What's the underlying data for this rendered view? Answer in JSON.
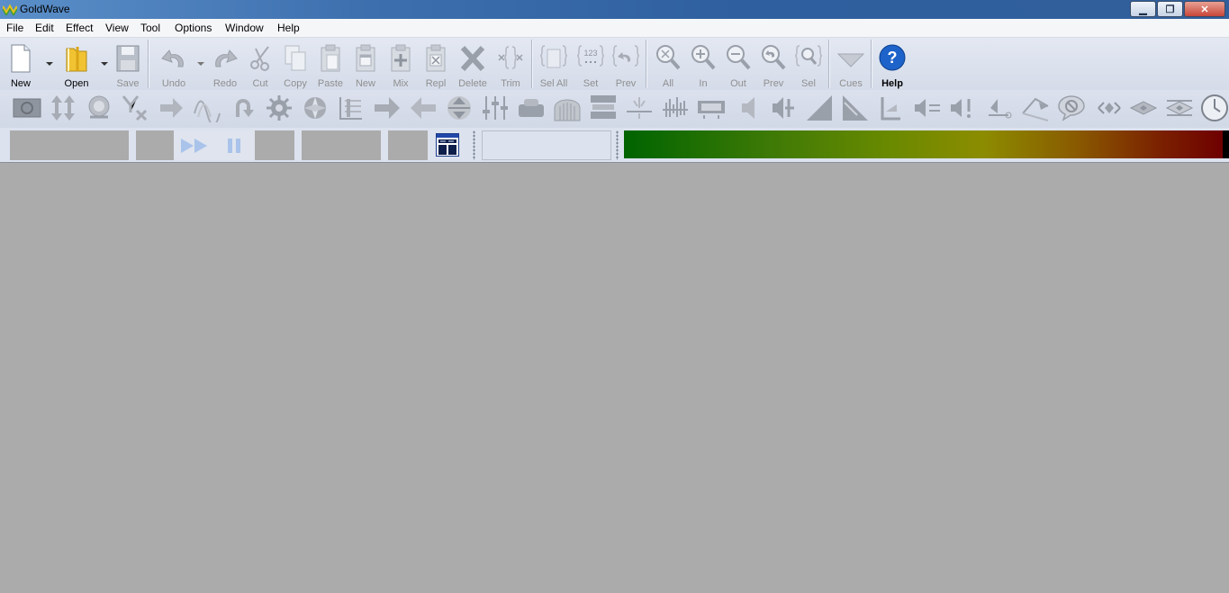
{
  "window": {
    "title": "GoldWave",
    "min_icon": "minimize-icon",
    "max_icon": "restore-icon",
    "close_icon": "close-icon"
  },
  "menu": [
    "File",
    "Edit",
    "Effect",
    "View",
    "Tool",
    "Options",
    "Window",
    "Help"
  ],
  "toolbar": {
    "new": "New",
    "open": "Open",
    "save": "Save",
    "undo": "Undo",
    "redo": "Redo",
    "cut": "Cut",
    "copy": "Copy",
    "paste": "Paste",
    "paste_new": "New",
    "mix": "Mix",
    "replace": "Repl",
    "delete": "Delete",
    "trim": "Trim",
    "sel_all": "Sel All",
    "set": "Set",
    "prev_sel": "Prev",
    "zoom_all": "All",
    "zoom_in": "In",
    "zoom_out": "Out",
    "zoom_prev": "Prev",
    "zoom_sel": "Sel",
    "cues": "Cues",
    "help": "Help",
    "set_icon_text": "123"
  },
  "effects": [
    "compressor-icon",
    "doppler-icon",
    "echo-icon",
    "expander-icon",
    "fade-in-icon",
    "flanger-icon",
    "invert-icon",
    "mechanize-icon",
    "noise-reduction-icon",
    "equalizer-icon",
    "offset-icon",
    "pan-icon",
    "pitch-icon",
    "parametric-eq-icon",
    "playback-rate-icon",
    "reverb-icon",
    "resample-icon",
    "silence-reduction-icon",
    "spatial-icon",
    "time-warp-icon",
    "volume-change-icon",
    "volume-match-icon",
    "fade-out-icon",
    "shape-icon",
    "auto-gain-icon",
    "mute-icon",
    "maximize-icon",
    "replace-icon",
    "interpolate-icon",
    "filter-icon",
    "channel-left-icon",
    "channel-both-icon",
    "channel-right-icon",
    "clock-icon"
  ],
  "transport": {
    "play_icon": "fast-forward-icon",
    "pause_icon": "pause-icon"
  },
  "colors": {
    "title_bar": "#3d6fae",
    "workspace": "#ababab",
    "meter_start": "#006400",
    "meter_end": "#6e0000"
  }
}
